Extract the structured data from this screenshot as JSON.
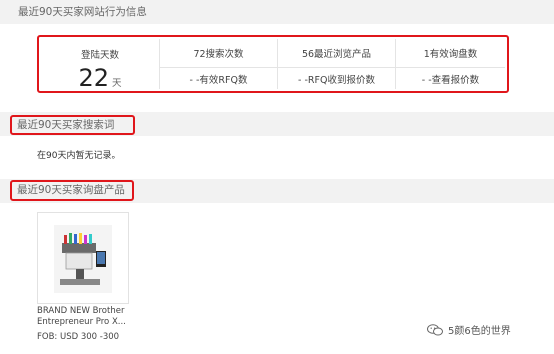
{
  "sections": {
    "behavior": "最近90天买家网站行为信息",
    "search": "最近90天买家搜索词",
    "inquiry": "最近90天买家询盘产品"
  },
  "stats": {
    "login_label": "登陆天数",
    "login_value": "22",
    "login_unit": "天",
    "top_cells": [
      "72搜索次数",
      "56最近浏览产品",
      "1有效询盘数"
    ],
    "bottom_cells": [
      "- -有效RFQ数",
      "- -RFQ收到报价数",
      "- -查看报价数"
    ]
  },
  "search_empty": "在90天内暂无记录。",
  "product": {
    "title_line1": "BRAND NEW Brother",
    "title_line2": "Entrepreneur Pro X...",
    "price": "FOB: USD 300 -300"
  },
  "watermark": "5颜6色的世界",
  "colors": {
    "highlight": "#e0161b",
    "section_bg": "#f2f2f2"
  }
}
